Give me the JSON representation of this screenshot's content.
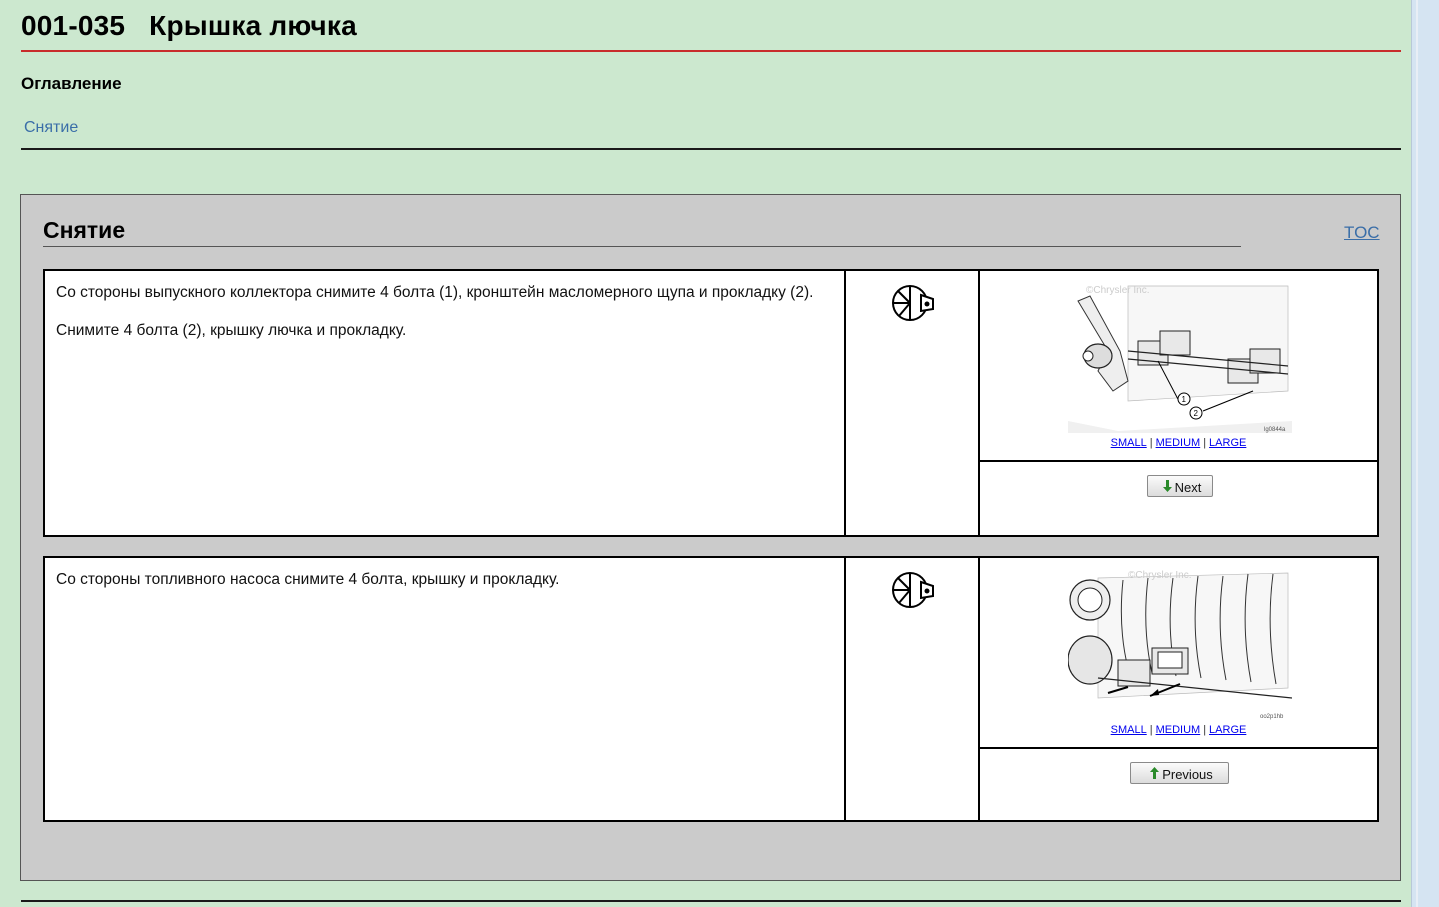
{
  "header": {
    "code": "001-035",
    "title": "Крышка лючка"
  },
  "toc": {
    "heading": "Оглавление",
    "links": [
      "Снятие"
    ]
  },
  "section": {
    "title": "Снятие",
    "toc_link": "TOC"
  },
  "steps": [
    {
      "paragraphs": [
        "Со стороны выпускного коллектора снимите 4 болта (1), кронштейн масломерного щупа и прокладку (2).",
        "Снимите 4 болта (2), крышку лючка и прокладку."
      ],
      "icon": "wrench-tool-icon",
      "image_labels": {
        "small": "SMALL",
        "medium": "MEDIUM",
        "large": "LARGE"
      },
      "image_watermark": "©Chrysler Inc.",
      "image_code": "lg0844a",
      "callouts": [
        "1",
        "2"
      ],
      "button": {
        "label": "Next",
        "icon": "arrow-down-icon",
        "color": "#2a8a2a"
      }
    },
    {
      "paragraphs": [
        "Со стороны топливного насоса снимите 4 болта, крышку и прокладку."
      ],
      "icon": "wrench-tool-icon",
      "image_labels": {
        "small": "SMALL",
        "medium": "MEDIUM",
        "large": "LARGE"
      },
      "image_watermark": "©Chrysler Inc.",
      "image_code": "oo2p1hb",
      "button": {
        "label": "Previous",
        "icon": "arrow-up-icon",
        "color": "#2a8a2a"
      }
    }
  ],
  "colors": {
    "page_bg": "#cce8cf",
    "section_bg": "#cbcbcb",
    "title_rule": "#c82c2c",
    "link": "#3a6ea8"
  }
}
